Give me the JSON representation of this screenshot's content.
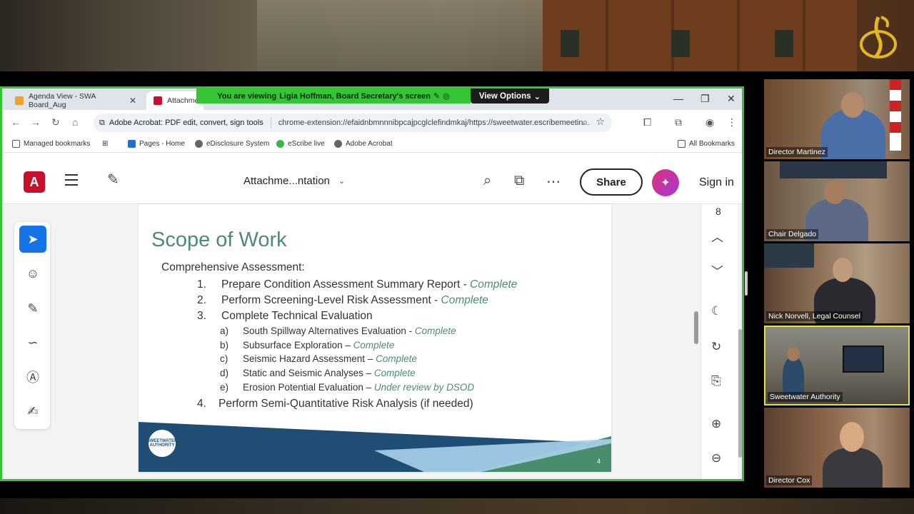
{
  "browser": {
    "tabs": [
      {
        "label": "Agenda View - SWA Board_Aug",
        "close": "✕"
      },
      {
        "label": "Attachmen"
      }
    ],
    "window_controls": {
      "minimize": "—",
      "maximize": "❐",
      "close": "✕"
    },
    "address": {
      "site_label": "Adobe Acrobat: PDF edit, convert, sign tools",
      "url": "chrome-extension://efaidnbmnnnibpcajpcglclefindmkaj/https://sweetwater.escribemeetin..."
    },
    "bookmarks": [
      {
        "label": "Managed bookmarks"
      },
      {
        "label": "Pages - Home"
      },
      {
        "label": "eDisclosure System"
      },
      {
        "label": "eScribe live"
      },
      {
        "label": "Adobe Acrobat"
      }
    ],
    "all_bookmarks": "All Bookmarks"
  },
  "share_banner": {
    "prefix": "You are viewing",
    "presenter": "Ligia Hoffman, Board Secretary's screen",
    "view_options": "View Options"
  },
  "acrobat": {
    "logo": "A",
    "doc_title": "Attachme...ntation",
    "share_label": "Share",
    "sign_in_label": "Sign in",
    "page_indicator": "8"
  },
  "slide": {
    "title": "Scope of Work",
    "lead": "Comprehensive Assessment:",
    "items": [
      {
        "num": "1.",
        "text": "Prepare Condition Assessment Summary Report - ",
        "status": "Complete"
      },
      {
        "num": "2.",
        "text": "Perform Screening-Level Risk Assessment - ",
        "status": "Complete"
      },
      {
        "num": "3.",
        "text": "Complete Technical Evaluation",
        "status": ""
      }
    ],
    "subitems": [
      {
        "letter": "a)",
        "text": "South Spillway Alternatives Evaluation - ",
        "status": "Complete"
      },
      {
        "letter": "b)",
        "text": "Subsurface Exploration – ",
        "status": "Complete"
      },
      {
        "letter": "c)",
        "text": "Seismic Hazard Assessment – ",
        "status": "Complete"
      },
      {
        "letter": "d)",
        "text": "Static and Seismic Analyses – ",
        "status": "Complete"
      },
      {
        "letter": "e)",
        "text": "Erosion Potential Evaluation – ",
        "status": "Under review by DSOD"
      }
    ],
    "last_item": {
      "num": "4.",
      "text": "Perform Semi-Quantitative Risk Analysis (if needed)"
    },
    "seal_text": "SWEETWATER AUTHORITY",
    "page_number": "4"
  },
  "participants": [
    {
      "name": "Director Martinez"
    },
    {
      "name": "Chair Delgado"
    },
    {
      "name": "Nick Norvell, Legal Counsel"
    },
    {
      "name": "Sweetwater Authority"
    },
    {
      "name": "Director Cox"
    }
  ],
  "colors": {
    "share_border": "#34c435",
    "slide_green": "#4f8a74",
    "slide_navy": "#1f4d73",
    "acrobat_red": "#c8102e",
    "active_tile": "#e8e33a"
  }
}
